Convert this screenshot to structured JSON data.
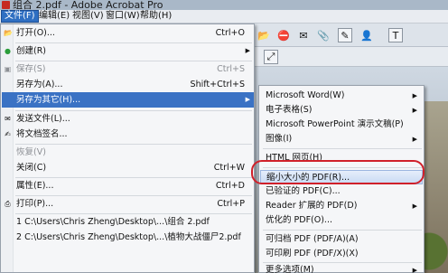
{
  "window": {
    "title": "组合 2.pdf - Adobe Acrobat Pro"
  },
  "menubar": {
    "items": [
      "文件(F)",
      "编辑(E)",
      "视图(V)",
      "窗口(W)",
      "帮助(H)"
    ]
  },
  "file_menu": {
    "open": {
      "label": "打开(O)...",
      "shortcut": "Ctrl+O"
    },
    "create": {
      "label": "创建(R)"
    },
    "save": {
      "label": "保存(S)",
      "shortcut": "Ctrl+S"
    },
    "save_as": {
      "label": "另存为(A)...",
      "shortcut": "Shift+Ctrl+S"
    },
    "save_as_other": {
      "label": "另存为其它(H)..."
    },
    "send_file": {
      "label": "发送文件(L)..."
    },
    "sign_document": {
      "label": "将文档签名..."
    },
    "revert": {
      "label": "恢复(V)"
    },
    "close": {
      "label": "关闭(C)",
      "shortcut": "Ctrl+W"
    },
    "properties": {
      "label": "属性(E)...",
      "shortcut": "Ctrl+D"
    },
    "print": {
      "label": "打印(P)...",
      "shortcut": "Ctrl+P"
    },
    "recent_1": {
      "label": "1 C:\\Users\\Chris Zheng\\Desktop\\...\\组合 2.pdf"
    },
    "recent_2": {
      "label": "2 C:\\Users\\Chris Zheng\\Desktop\\...\\植物大战僵尸2.pdf"
    }
  },
  "submenu": {
    "word": "Microsoft Word(W)",
    "spreadsheet": "电子表格(S)",
    "powerpoint": "Microsoft PowerPoint 演示文稿(P)",
    "image": "图像(I)",
    "html": "HTML 网页(H)",
    "reduced_size": "缩小大小的 PDF(R)...",
    "certified": "已验证的 PDF(C)...",
    "reader_extended": "Reader 扩展的 PDF(D)",
    "optimized": "优化的 PDF(O)...",
    "archivable": "可归档 PDF (PDF/A)(A)",
    "printable": "可印刷 PDF (PDF/X)(X)",
    "more_options": "更多选项(M)"
  },
  "colors": {
    "highlight": "#3a72c4",
    "annotation": "#d0202a"
  }
}
